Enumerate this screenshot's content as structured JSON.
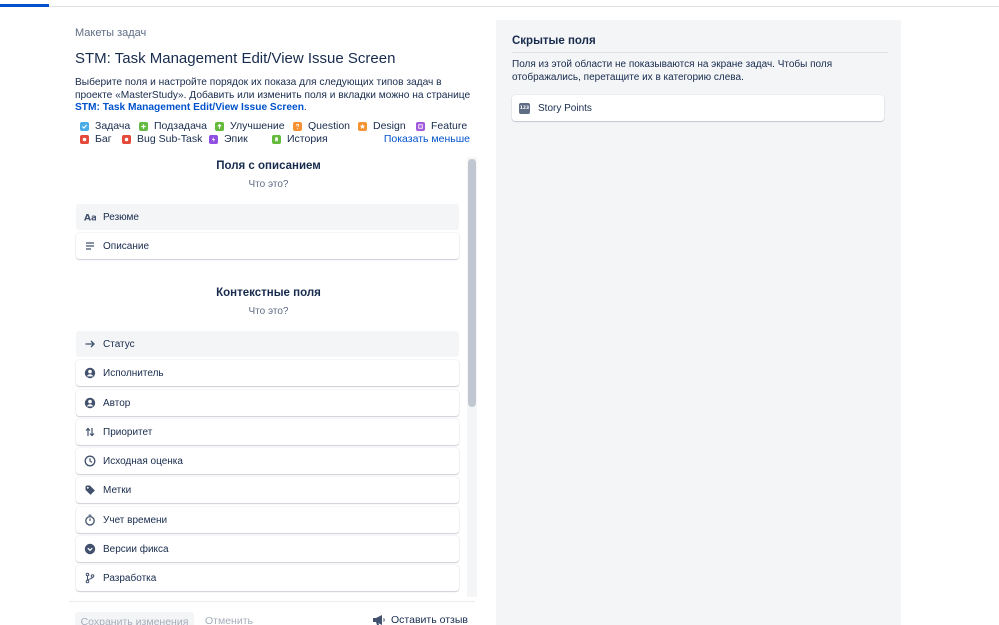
{
  "breadcrumb": "Макеты задач",
  "title": "STM: Task Management Edit/View Issue Screen",
  "description": {
    "text": "Выберите поля и настройте порядок их показа для следующих типов задач в проекте «MasterStudy». Добавить или изменить поля и вкладки можно на странице ",
    "link": "STM: Task Management Edit/View Issue Screen",
    "end": "."
  },
  "issue_types": [
    {
      "label": "Задача",
      "color": "#4bade8",
      "icon": "check-icon"
    },
    {
      "label": "Подзадача",
      "color": "#65ba43",
      "icon": "plus-icon"
    },
    {
      "label": "Улучшение",
      "color": "#63ba3c",
      "icon": "arrow-up-icon"
    },
    {
      "label": "Question",
      "color": "#f79232",
      "icon": "question-icon"
    },
    {
      "label": "Design",
      "color": "#f79232",
      "icon": "star-icon"
    },
    {
      "label": "Feature",
      "color": "#a15bdc",
      "icon": "square-icon"
    },
    {
      "label": "Баг",
      "color": "#e5493a",
      "icon": "dot-icon"
    },
    {
      "label": "Bug Sub-Task",
      "color": "#e5493a",
      "icon": "dot-icon"
    },
    {
      "label": "Эпик",
      "color": "#904ee2",
      "icon": "lightning-icon"
    },
    {
      "label": "История",
      "color": "#63ba3c",
      "icon": "bookmark-icon"
    }
  ],
  "show_less": "Показать меньше",
  "sections": [
    {
      "title": "Поля с описанием",
      "subtitle": "Что это?",
      "fields": [
        {
          "label": "Резюме",
          "icon": "text-aa-icon",
          "active": true
        },
        {
          "label": "Описание",
          "icon": "paragraph-icon",
          "active": false
        }
      ]
    },
    {
      "title": "Контекстные поля",
      "subtitle": "Что это?",
      "fields": [
        {
          "label": "Статус",
          "icon": "arrow-right-icon",
          "active": true
        },
        {
          "label": "Исполнитель",
          "icon": "user-icon",
          "active": false
        },
        {
          "label": "Автор",
          "icon": "user-icon",
          "active": false
        },
        {
          "label": "Приоритет",
          "icon": "priority-icon",
          "active": false
        },
        {
          "label": "Исходная оценка",
          "icon": "clock-icon",
          "active": false
        },
        {
          "label": "Метки",
          "icon": "label-icon",
          "active": false
        },
        {
          "label": "Учет времени",
          "icon": "stopwatch-icon",
          "active": false
        },
        {
          "label": "Версии фикса",
          "icon": "version-icon",
          "active": false
        },
        {
          "label": "Разработка",
          "icon": "branch-icon",
          "active": false
        }
      ]
    }
  ],
  "footer": {
    "save": "Сохранить изменения",
    "cancel": "Отменить",
    "feedback": "Оставить отзыв"
  },
  "hidden_fields": {
    "title": "Скрытые поля",
    "description": "Поля из этой области не показываются на экране задач. Чтобы поля отображались, перетащите их в категорию слева.",
    "items": [
      {
        "label": "Story Points",
        "icon": "number-icon",
        "badge": "123"
      }
    ]
  }
}
